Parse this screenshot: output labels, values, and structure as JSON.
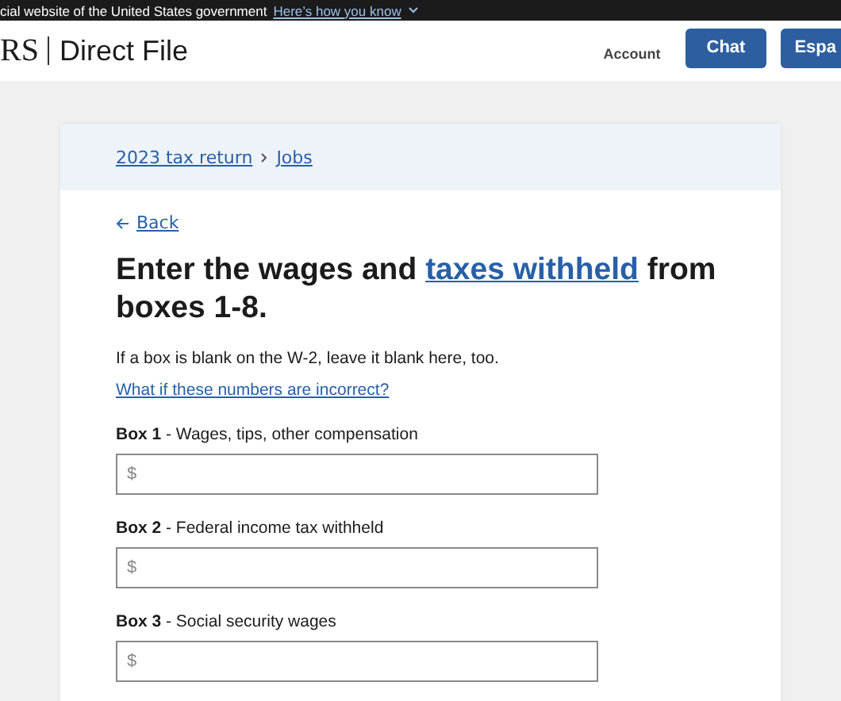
{
  "banner": {
    "text": "cial website of the United States government",
    "link": "Here’s how you know"
  },
  "header": {
    "logo": "RS",
    "title": "Direct File",
    "account": "Account",
    "buttons": [
      "Chat",
      "Espa"
    ]
  },
  "breadcrumb": [
    "2023 tax return",
    "Jobs"
  ],
  "back": "Back",
  "heading": {
    "before": "Enter the wages and ",
    "link": "taxes withheld",
    "after": " from boxes 1-8."
  },
  "intro": "If a box is blank on the W-2, leave it blank here, too.",
  "help_link": "What if these numbers are incorrect?",
  "fields": [
    {
      "label": "**Box 1** - Wages, tips, other compensation",
      "placeholder": "$"
    },
    {
      "label": "**Box 2** - Federal income tax withheld",
      "placeholder": "$"
    },
    {
      "label": "**Box 3** - Social security wages",
      "placeholder": "$"
    }
  ]
}
